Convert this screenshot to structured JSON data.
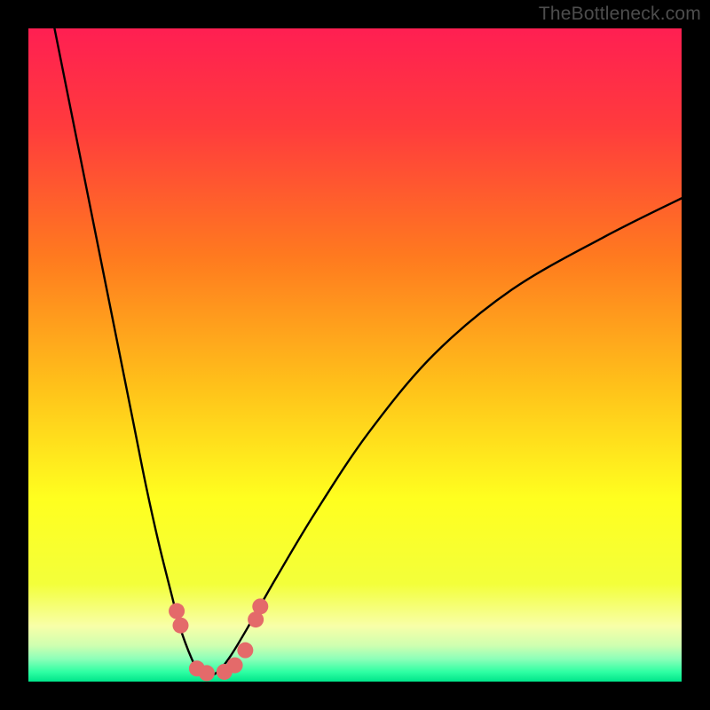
{
  "watermark": "TheBottleneck.com",
  "chart_data": {
    "type": "line",
    "title": "",
    "xlabel": "",
    "ylabel": "",
    "xlim": [
      0,
      100
    ],
    "ylim": [
      0,
      100
    ],
    "notes": "V-shaped bottleneck curve; minimum (optimal match) near x≈27. Background vertical gradient encodes severity: green (y≈0, good) → yellow → orange → red (y≈100, bad). No numeric tick labels are shown on the image.",
    "series": [
      {
        "name": "left-branch",
        "x": [
          4,
          8,
          12,
          16,
          18,
          20,
          22,
          23,
          24,
          25,
          26,
          27
        ],
        "values": [
          100,
          80,
          60,
          40,
          30,
          21,
          13,
          9,
          6,
          3.5,
          1.5,
          0.5
        ]
      },
      {
        "name": "right-branch",
        "x": [
          27,
          29,
          31,
          34,
          38,
          44,
          52,
          62,
          74,
          88,
          100
        ],
        "values": [
          0.5,
          1.5,
          4,
          9,
          16,
          26,
          38,
          50,
          60,
          68,
          74
        ]
      }
    ],
    "markers": [
      {
        "name": "left-upper-dot-1",
        "x": 22.7,
        "y": 10.8
      },
      {
        "name": "left-upper-dot-2",
        "x": 23.3,
        "y": 8.6
      },
      {
        "name": "left-floor-dot-1",
        "x": 25.8,
        "y": 2.0
      },
      {
        "name": "left-floor-dot-2",
        "x": 27.3,
        "y": 1.3
      },
      {
        "name": "right-floor-dot-1",
        "x": 30.0,
        "y": 1.5
      },
      {
        "name": "right-floor-dot-2",
        "x": 31.6,
        "y": 2.5
      },
      {
        "name": "right-floor-dot-3",
        "x": 33.2,
        "y": 4.8
      },
      {
        "name": "right-upper-dot-1",
        "x": 34.8,
        "y": 9.5
      },
      {
        "name": "right-upper-dot-2",
        "x": 35.5,
        "y": 11.5
      }
    ],
    "gradient_stops": [
      {
        "pos": 0.0,
        "color": "#ff1f52"
      },
      {
        "pos": 0.15,
        "color": "#ff3b3d"
      },
      {
        "pos": 0.35,
        "color": "#ff7a1f"
      },
      {
        "pos": 0.55,
        "color": "#ffc21a"
      },
      {
        "pos": 0.72,
        "color": "#ffff1f"
      },
      {
        "pos": 0.85,
        "color": "#f3ff3a"
      },
      {
        "pos": 0.915,
        "color": "#f8ffa8"
      },
      {
        "pos": 0.945,
        "color": "#ceffb0"
      },
      {
        "pos": 0.965,
        "color": "#8dffb9"
      },
      {
        "pos": 0.985,
        "color": "#2fffa3"
      },
      {
        "pos": 1.0,
        "color": "#00e58a"
      }
    ],
    "marker_color": "#e46a6a",
    "curve_color": "#000000"
  }
}
